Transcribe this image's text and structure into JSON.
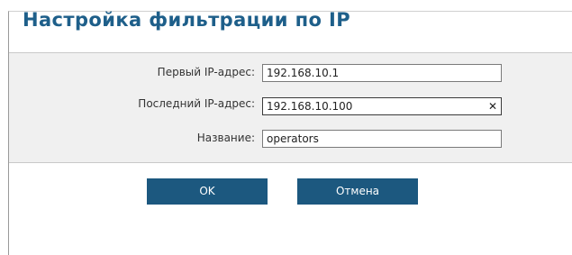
{
  "dialog": {
    "title": "Настройка фильтрации по IP"
  },
  "form": {
    "first_ip": {
      "label": "Первый IP-адрес:",
      "value": "192.168.10.1"
    },
    "last_ip": {
      "label": "Последний IP-адрес:",
      "value": "192.168.10.100",
      "clear_glyph": "✕"
    },
    "name": {
      "label": "Название:",
      "value": "operators"
    }
  },
  "buttons": {
    "ok_label": "OK",
    "cancel_label": "Отмена"
  },
  "colors": {
    "title": "#1e5f8a",
    "button_bg": "#1c587f",
    "form_bg": "#f0f0f0"
  },
  "icons": {
    "clear": "close-icon"
  }
}
